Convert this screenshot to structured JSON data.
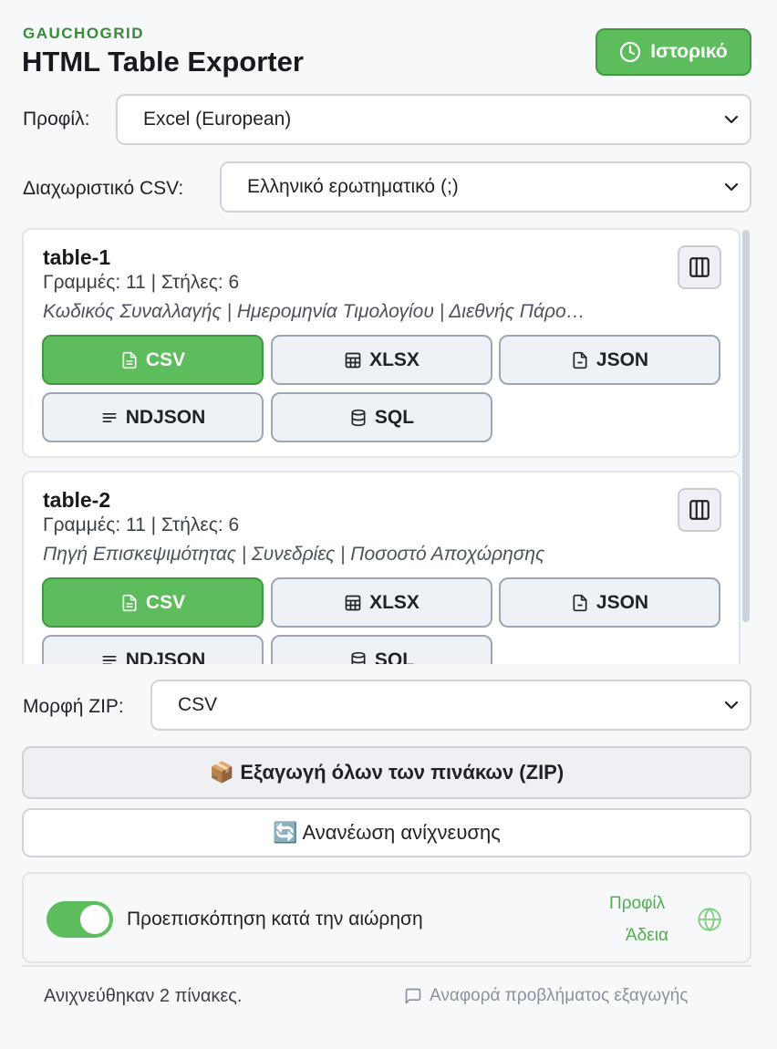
{
  "header": {
    "brand": "GAUCHOGRID",
    "title": "HTML Table Exporter",
    "history_label": "Ιστορικό"
  },
  "profile": {
    "label": "Προφίλ:",
    "value": "Excel (European)"
  },
  "delimiter": {
    "label": "Διαχωριστικό CSV:",
    "value": "Ελληνικό ερωτηματικό (;)"
  },
  "tables": [
    {
      "name": "table-1",
      "meta": "Γραμμές: 11 | Στήλες: 6",
      "columns": "Κωδικός Συναλλαγής | Ημερομηνία Τιμολογίου | Διεθνής Πάρο…"
    },
    {
      "name": "table-2",
      "meta": "Γραμμές: 11 | Στήλες: 6",
      "columns": "Πηγή Επισκεψιμότητας | Συνεδρίες | Ποσοστό Αποχώρησης"
    }
  ],
  "formats": {
    "csv": "CSV",
    "xlsx": "XLSX",
    "json": "JSON",
    "ndjson": "NDJSON",
    "sql": "SQL"
  },
  "zip": {
    "label": "Μορφή ZIP:",
    "value": "CSV",
    "export_all": "📦 Εξαγωγή όλων των πινάκων (ZIP)",
    "refresh": "🔄 Ανανέωση ανίχνευσης"
  },
  "settings": {
    "hover_preview_label": "Προεπισκόπηση κατά την αιώρηση",
    "hover_preview_on": true,
    "profile_link": "Προφίλ",
    "license_link": "Άδεια"
  },
  "footer": {
    "status": "Ανιχνεύθηκαν 2 πίνακες.",
    "report": "Αναφορά προβλήματος εξαγωγής"
  },
  "colors": {
    "accent": "#5dbd5d",
    "brand": "#3a8a3a"
  }
}
